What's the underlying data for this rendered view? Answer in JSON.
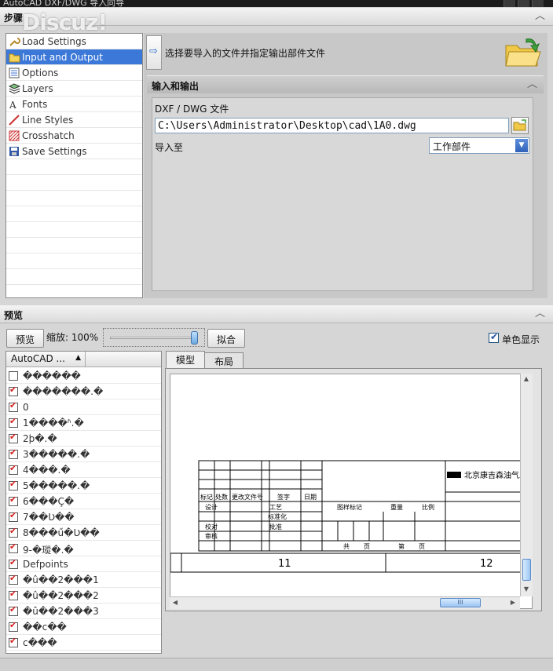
{
  "window": {
    "title": "AutoCAD DXF/DWG 导入向导"
  },
  "watermark": "Discuz!",
  "steps_section": {
    "title": "步骤"
  },
  "steps": [
    {
      "label": "Load Settings",
      "icon": "wrench-icon"
    },
    {
      "label": "Input and Output",
      "icon": "folder-icon",
      "selected": true
    },
    {
      "label": "Options",
      "icon": "options-icon"
    },
    {
      "label": "Layers",
      "icon": "layers-icon"
    },
    {
      "label": "Fonts",
      "icon": "fonts-icon"
    },
    {
      "label": "Line Styles",
      "icon": "line-icon"
    },
    {
      "label": "Crosshatch",
      "icon": "crosshatch-icon"
    },
    {
      "label": "Save Settings",
      "icon": "save-icon"
    }
  ],
  "instruction": "选择要导入的文件并指定输出部件文件",
  "io": {
    "title": "输入和输出",
    "file_label": "DXF / DWG 文件",
    "file_path": "C:\\Users\\Administrator\\Desktop\\cad\\1A0.dwg",
    "import_to_label": "导入至",
    "import_to_value": "工作部件"
  },
  "preview_section": {
    "title": "预览"
  },
  "preview": {
    "preview_button": "预览",
    "zoom_label": "缩放: 100%",
    "zoom_value": 1.0,
    "fit_button": "拟合",
    "monochrome_label": "单色显示",
    "monochrome_checked": true
  },
  "layers": {
    "column_header": "AutoCAD ...",
    "items": [
      {
        "name": "������",
        "checked": false
      },
      {
        "name": "�������.�",
        "checked": true
      },
      {
        "name": "0",
        "checked": true
      },
      {
        "name": "1����ʱ.�",
        "checked": true
      },
      {
        "name": "2þ�.�",
        "checked": true
      },
      {
        "name": "3�����.�",
        "checked": true
      },
      {
        "name": "4���.�",
        "checked": true
      },
      {
        "name": "5�����.�",
        "checked": true
      },
      {
        "name": "6���Ç�",
        "checked": true
      },
      {
        "name": "7��Ʋ��",
        "checked": true
      },
      {
        "name": "8���ű�Ʋ��",
        "checked": true
      },
      {
        "name": "9-�瑽�.�",
        "checked": true
      },
      {
        "name": "Defpoints",
        "checked": true
      },
      {
        "name": "�û��2���1",
        "checked": true
      },
      {
        "name": "�û��2���2",
        "checked": true
      },
      {
        "name": "�û��2���3",
        "checked": true
      },
      {
        "name": "��c��",
        "checked": true
      },
      {
        "name": "c���",
        "checked": true
      }
    ]
  },
  "tabs": [
    {
      "label": "模型",
      "active": true
    },
    {
      "label": "布局",
      "active": false
    }
  ],
  "drawing": {
    "company": "北京康吉森油气工",
    "cells": [
      "标记",
      "处数",
      "更改文件号",
      "签字",
      "日期",
      "设计",
      "工艺",
      "图样标记",
      "重量",
      "比例",
      "标准化",
      "校对",
      "批准",
      "审核",
      "共",
      "页",
      "第",
      "页"
    ],
    "grid_numbers": [
      "11",
      "12"
    ]
  },
  "scroll": {
    "thumb_glyph": "III"
  }
}
